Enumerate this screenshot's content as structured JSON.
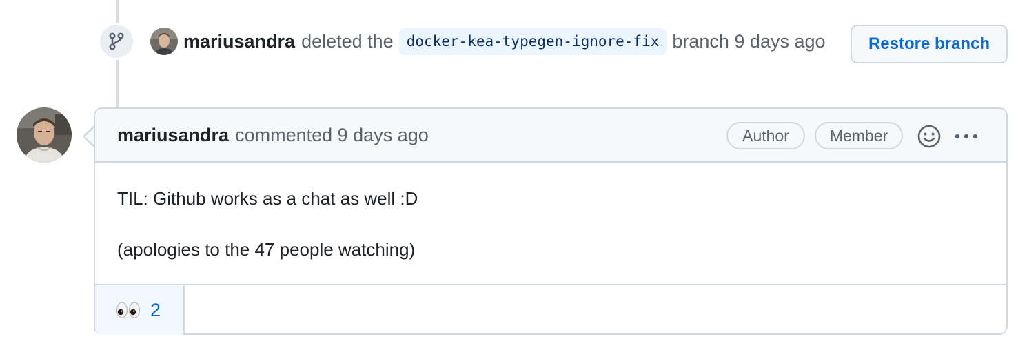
{
  "event": {
    "author": "mariusandra",
    "action_text": "deleted the",
    "branch_name": "docker-kea-typegen-ignore-fix",
    "suffix_text": "branch 9 days ago",
    "restore_button_label": "Restore branch",
    "icon": "git-branch-icon"
  },
  "comment": {
    "author": "mariusandra",
    "meta_text": "commented 9 days ago",
    "labels": {
      "author": "Author",
      "member": "Member"
    },
    "body": [
      "TIL: Github works as a chat as well :D",
      "(apologies to the 47 people watching)"
    ],
    "reaction": {
      "emoji": "👀",
      "count": "2"
    }
  },
  "colors": {
    "link_blue": "#0969da",
    "border": "#d1d9e0",
    "header_bg": "#f6f8fa",
    "code_text": "#0a3069"
  }
}
